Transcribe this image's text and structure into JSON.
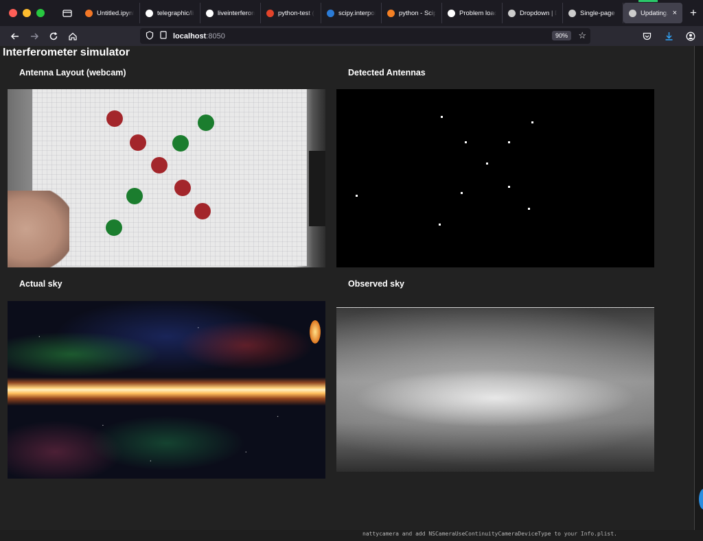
{
  "browser": {
    "tabs": [
      {
        "title": "Untitled.ipynb",
        "icon": "jupyter-icon",
        "color": "#f37726"
      },
      {
        "title": "telegraphic/liv",
        "icon": "github-icon",
        "color": "#ffffff"
      },
      {
        "title": "liveinterferom",
        "icon": "github-icon",
        "color": "#ffffff"
      },
      {
        "title": "python-test (",
        "icon": "gitlab-icon",
        "color": "#e2432a"
      },
      {
        "title": "scipy.interpola",
        "icon": "scipy-icon",
        "color": "#2b7bd6"
      },
      {
        "title": "python - Scip",
        "icon": "stackoverflow-icon",
        "color": "#f48024"
      },
      {
        "title": "Problem loadi",
        "icon": "info-icon",
        "color": "#ffffff"
      },
      {
        "title": "Dropdown | D",
        "icon": "dash-icon",
        "color": "#cccccc"
      },
      {
        "title": "Single-page a",
        "icon": "dash-icon",
        "color": "#cccccc"
      },
      {
        "title": "Updating...",
        "icon": "dash-icon",
        "color": "#cccccc",
        "active": true
      }
    ],
    "new_tab_label": "+",
    "close_tab_label": "×",
    "url_host": "localhost",
    "url_port": ":8050",
    "zoom": "90%"
  },
  "page": {
    "title": "Interferometer simulator",
    "panels": {
      "webcam": "Antenna Layout (webcam)",
      "detected": "Detected Antennas",
      "actual": "Actual sky",
      "observed": "Observed sky"
    }
  },
  "terminal": {
    "line": "nattycamera and add NSCameraUseContinuityCameraDeviceType to your Info.plist."
  },
  "colors": {
    "background": "#222222",
    "chrome": "#1c1b22",
    "toolbar": "#2b2a33",
    "antenna_red": "#a3262b",
    "antenna_green": "#1b7d2e",
    "download_accent": "#31a8ff"
  }
}
